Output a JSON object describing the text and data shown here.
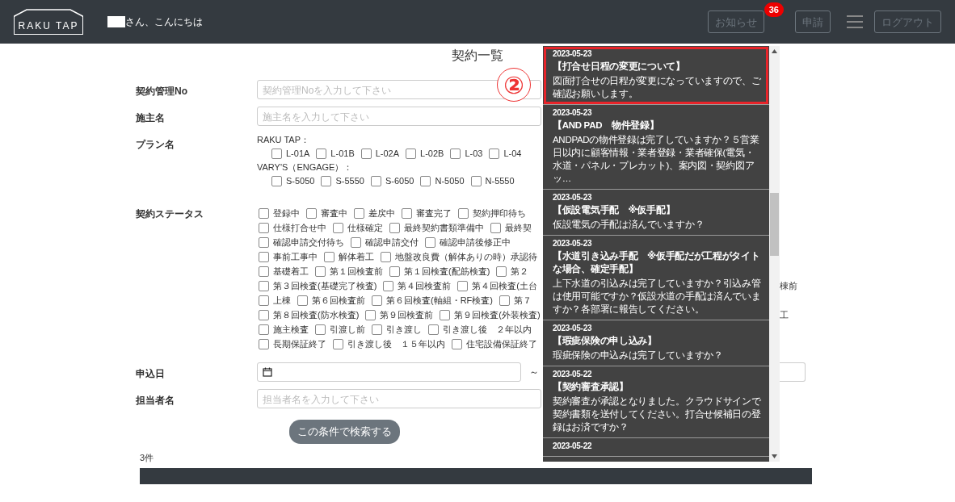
{
  "header": {
    "logo": "RAKU TAP",
    "greeting": "さん、こんにちは",
    "notice_button": "お知らせ",
    "notice_count": "36",
    "apply_button": "申請",
    "logout_button": "ログアウト"
  },
  "title": "契約一覧",
  "form": {
    "contract_no": {
      "label": "契約管理No",
      "placeholder": "契約管理Noを入力して下さい"
    },
    "owner": {
      "label": "施主名",
      "placeholder": "施主名を入力して下さい"
    },
    "plan": {
      "label": "プラン名",
      "groups": [
        {
          "name": "RAKU TAP：",
          "items": [
            {
              "label": "L-01A",
              "checked": false
            },
            {
              "label": "L-01B",
              "checked": false
            },
            {
              "label": "L-02A",
              "checked": false
            },
            {
              "label": "L-02B",
              "checked": false
            },
            {
              "label": "L-03",
              "checked": false
            },
            {
              "label": "L-04",
              "checked": false
            }
          ]
        },
        {
          "name": "VARY'S（ENGAGE）：",
          "items": [
            {
              "label": "S-5050",
              "checked": false
            },
            {
              "label": "S-5550",
              "checked": false
            },
            {
              "label": "S-6050",
              "checked": false
            },
            {
              "label": "N-5050",
              "checked": false
            },
            {
              "label": "N-5550",
              "checked": false
            }
          ]
        }
      ]
    },
    "status": {
      "label": "契約ステータス",
      "rows": [
        {
          "items": [
            {
              "label": "登録中",
              "checked": false
            },
            {
              "label": "審査中",
              "checked": false
            },
            {
              "label": "差戻中",
              "checked": false
            },
            {
              "label": "審査完了",
              "checked": false
            },
            {
              "label": "契約押印待ち",
              "checked": false
            }
          ]
        },
        {
          "items": [
            {
              "label": "仕様打合せ中",
              "checked": false
            },
            {
              "label": "仕様確定",
              "checked": false
            },
            {
              "label": "最終契約書類準備中",
              "checked": false
            },
            {
              "label": "最終契",
              "checked": false
            }
          ]
        },
        {
          "items": [
            {
              "label": "確認申請交付待ち",
              "checked": false
            },
            {
              "label": "確認申請交付",
              "checked": false
            },
            {
              "label": "確認申請後修正中",
              "checked": false
            }
          ]
        },
        {
          "items": [
            {
              "label": "事前工事中",
              "checked": false
            },
            {
              "label": "解体着工",
              "checked": false
            },
            {
              "label": "地盤改良費（解体ありの時）承認待",
              "checked": false
            }
          ]
        },
        {
          "items": [
            {
              "label": "基礎着工",
              "checked": false
            },
            {
              "label": "第１回検査前",
              "checked": false
            },
            {
              "label": "第１回検査(配筋検査)",
              "checked": false
            },
            {
              "label": "第２",
              "checked": false
            }
          ]
        },
        {
          "items": [
            {
              "label": "第３回検査(基礎完了検査)",
              "checked": false
            },
            {
              "label": "第４回検査前",
              "checked": false
            },
            {
              "label": "第４回検査(土台",
              "checked": false
            }
          ],
          "trailing": "棟前"
        },
        {
          "items": [
            {
              "label": "上棟",
              "checked": false
            },
            {
              "label": "第６回検査前",
              "checked": false
            },
            {
              "label": "第６回検査(軸組・RF検査)",
              "checked": false
            },
            {
              "label": "第７",
              "checked": false
            }
          ]
        },
        {
          "items": [
            {
              "label": "第８回検査(防水検査)",
              "checked": false
            },
            {
              "label": "第９回検査前",
              "checked": false
            },
            {
              "label": "第９回検査(外装検査)",
              "checked": false
            }
          ],
          "trailing": "工"
        },
        {
          "items": [
            {
              "label": "施主検査",
              "checked": false
            },
            {
              "label": "引渡し前",
              "checked": false
            },
            {
              "label": "引き渡し",
              "checked": false
            },
            {
              "label": "引き渡し後　２年以内",
              "checked": false
            }
          ]
        },
        {
          "items": [
            {
              "label": "長期保証終了",
              "checked": false
            },
            {
              "label": "引き渡し後　１５年以内",
              "checked": false
            },
            {
              "label": "住宅設備保証終了",
              "checked": false
            }
          ]
        }
      ]
    },
    "apply_date": {
      "label": "申込日",
      "separator": "～"
    },
    "staff": {
      "label": "担当者名",
      "placeholder": "担当者名を入力して下さい"
    },
    "search_button": "この条件で検索する"
  },
  "result_count": "3件",
  "annotation": "②",
  "notifications": [
    {
      "date": "2023-05-23",
      "title": "【打合せ日程の変更について】",
      "body": "図面打合せの日程が変更になっていますので、ご確認お願いします。",
      "highlighted": true
    },
    {
      "date": "2023-05-23",
      "title": "【AND PAD　物件登録】",
      "body": "ANDPADの物件登録は完了していますか？５営業日以内に顧客情報・業者登録・業者確保(電気・水道・パネル・プレカット)、案内図・契約図アッ…",
      "highlighted": false
    },
    {
      "date": "2023-05-23",
      "title": "【仮設電気手配　※仮手配】",
      "body": "仮設電気の手配は済んでいますか？",
      "highlighted": false
    },
    {
      "date": "2023-05-23",
      "title": "【水道引き込み手配　※仮手配だが工程がタイトな場合、確定手配】",
      "body": "上下水道の引込みは完了していますか？引込み管は使用可能ですか？仮設水道の手配は済んでいますか？各部署に報告してください。",
      "highlighted": false
    },
    {
      "date": "2023-05-23",
      "title": "【瑕疵保険の申し込み】",
      "body": "瑕疵保険の申込みは完了していますか？",
      "highlighted": false
    },
    {
      "date": "2023-05-22",
      "title": "【契約審査承認】",
      "body": "契約審査が承認となりました。クラウドサインで契約書類を送付してください。打合せ候補日の登録はお済ですか？",
      "highlighted": false
    },
    {
      "date": "2023-05-22"
    }
  ]
}
